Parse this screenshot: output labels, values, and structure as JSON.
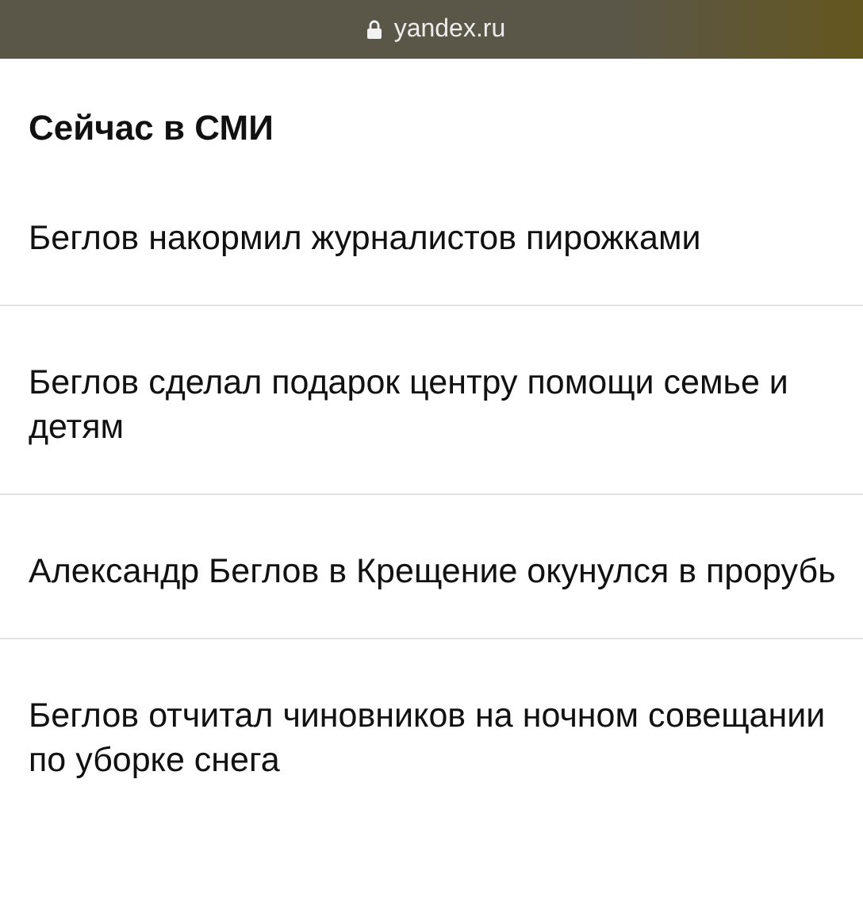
{
  "address_bar": {
    "url": "yandex.ru",
    "secure": true
  },
  "section": {
    "title": "Сейчас в СМИ"
  },
  "news": [
    {
      "headline": "Беглов накормил журналистов пирожками"
    },
    {
      "headline": "Беглов сделал подарок центру помощи семье и детям"
    },
    {
      "headline": "Александр Беглов в Крещение окунулся в прорубь"
    },
    {
      "headline": "Беглов отчитал чиновников на ночном совещании по уборке снега"
    }
  ]
}
